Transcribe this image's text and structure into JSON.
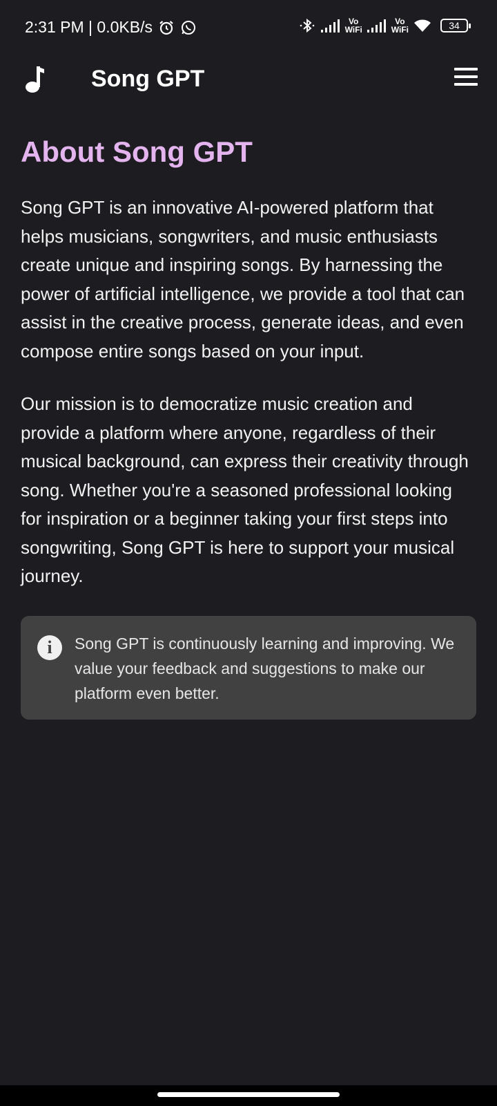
{
  "status_bar": {
    "time_speed": "2:31 PM | 0.0KB/s",
    "vowifi_1_top": "Vo",
    "vowifi_1_bottom": "WiFi",
    "vowifi_2_top": "Vo",
    "vowifi_2_bottom": "WiFi",
    "battery": "34"
  },
  "app_bar": {
    "title": "Song GPT",
    "logo_icon": "music-note-icon",
    "menu_icon": "hamburger-menu-icon"
  },
  "main": {
    "title": "About Song GPT",
    "paragraph_1": "Song GPT is an innovative AI-powered platform that helps musicians, songwriters, and music enthusiasts create unique and inspiring songs. By harnessing the power of artificial intelligence, we provide a tool that can assist in the creative process, generate ideas, and even compose entire songs based on your input.",
    "paragraph_2": "Our mission is to democratize music creation and provide a platform where anyone, regardless of their musical background, can express their creativity through song. Whether you're a seasoned professional looking for inspiration or a beginner taking your first steps into songwriting, Song GPT is here to support your musical journey.",
    "info_text": "Song GPT is continuously learning and improving. We value your feedback and suggestions to make our platform even better.",
    "info_icon_glyph": "i"
  },
  "colors": {
    "background": "#1d1c21",
    "title_accent": "#e3b4ed",
    "info_box": "#414141"
  }
}
